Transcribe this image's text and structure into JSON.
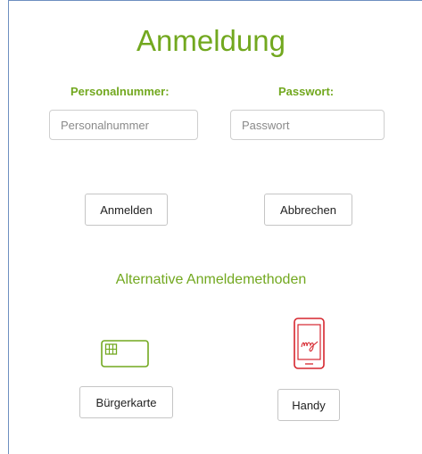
{
  "login": {
    "title": "Anmeldung",
    "personnel_label": "Personalnummer:",
    "personnel_placeholder": "Personalnummer",
    "personnel_value": "",
    "password_label": "Passwort:",
    "password_placeholder": "Passwort",
    "password_value": "",
    "login_button": "Anmelden",
    "cancel_button": "Abbrechen"
  },
  "alternatives": {
    "title": "Alternative Anmeldemethoden",
    "card_icon": "smartcard-chip-icon",
    "card_button": "Bürgerkarte",
    "phone_icon": "mobile-signature-icon",
    "phone_button": "Handy"
  },
  "colors": {
    "accent_green": "#72a81f",
    "phone_red": "#d6262e",
    "frame_blue": "#6e8fc0"
  }
}
